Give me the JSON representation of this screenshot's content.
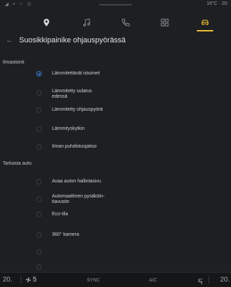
{
  "status": {
    "left_icons": "◢ ⌖ ♆ ◷",
    "right_text": "16°C · 20:"
  },
  "nav": {
    "tabs": [
      {
        "icon": "location-pin-icon",
        "active": false
      },
      {
        "icon": "music-note-icon",
        "active": false
      },
      {
        "icon": "phone-icon",
        "active": false
      },
      {
        "icon": "apps-grid-icon",
        "active": false
      },
      {
        "icon": "car-icon",
        "active": true
      }
    ]
  },
  "header": {
    "back_glyph": "←",
    "title": "Suosikkipainike ohjauspyörässä"
  },
  "sections": [
    {
      "title": "Ilmastointi",
      "options": [
        {
          "label": "Lämmitettävät istuimet",
          "checked": true
        },
        {
          "label": "Lämmitetty sulatus edessä",
          "checked": false
        },
        {
          "label": "Lämmitetty ohjauspyörä",
          "checked": false
        },
        {
          "label": "Lämmityskytkin",
          "checked": false
        },
        {
          "label": "Ilman puhdistusjakso",
          "checked": false
        }
      ]
    },
    {
      "title": "Tarkasta auto.",
      "options": [
        {
          "label": "Avaa auton hallintasivu",
          "checked": false
        },
        {
          "label": "Automaattinen pysäköin- tiavustin",
          "checked": false
        },
        {
          "label": "Eco-tila",
          "checked": false
        },
        {
          "label": "360° kamera",
          "checked": false
        },
        {
          "label": "",
          "checked": false
        },
        {
          "label": "",
          "checked": false
        }
      ]
    }
  ],
  "bottom_bar": {
    "temp_left": "20.",
    "fan_speed": "5",
    "sync_label": "SYNC",
    "ac_label": "A/C",
    "temp_right": "20."
  },
  "colors": {
    "accent_yellow": "#f1c232",
    "radio_blue": "#3c74c2",
    "background": "#1e1f22"
  }
}
